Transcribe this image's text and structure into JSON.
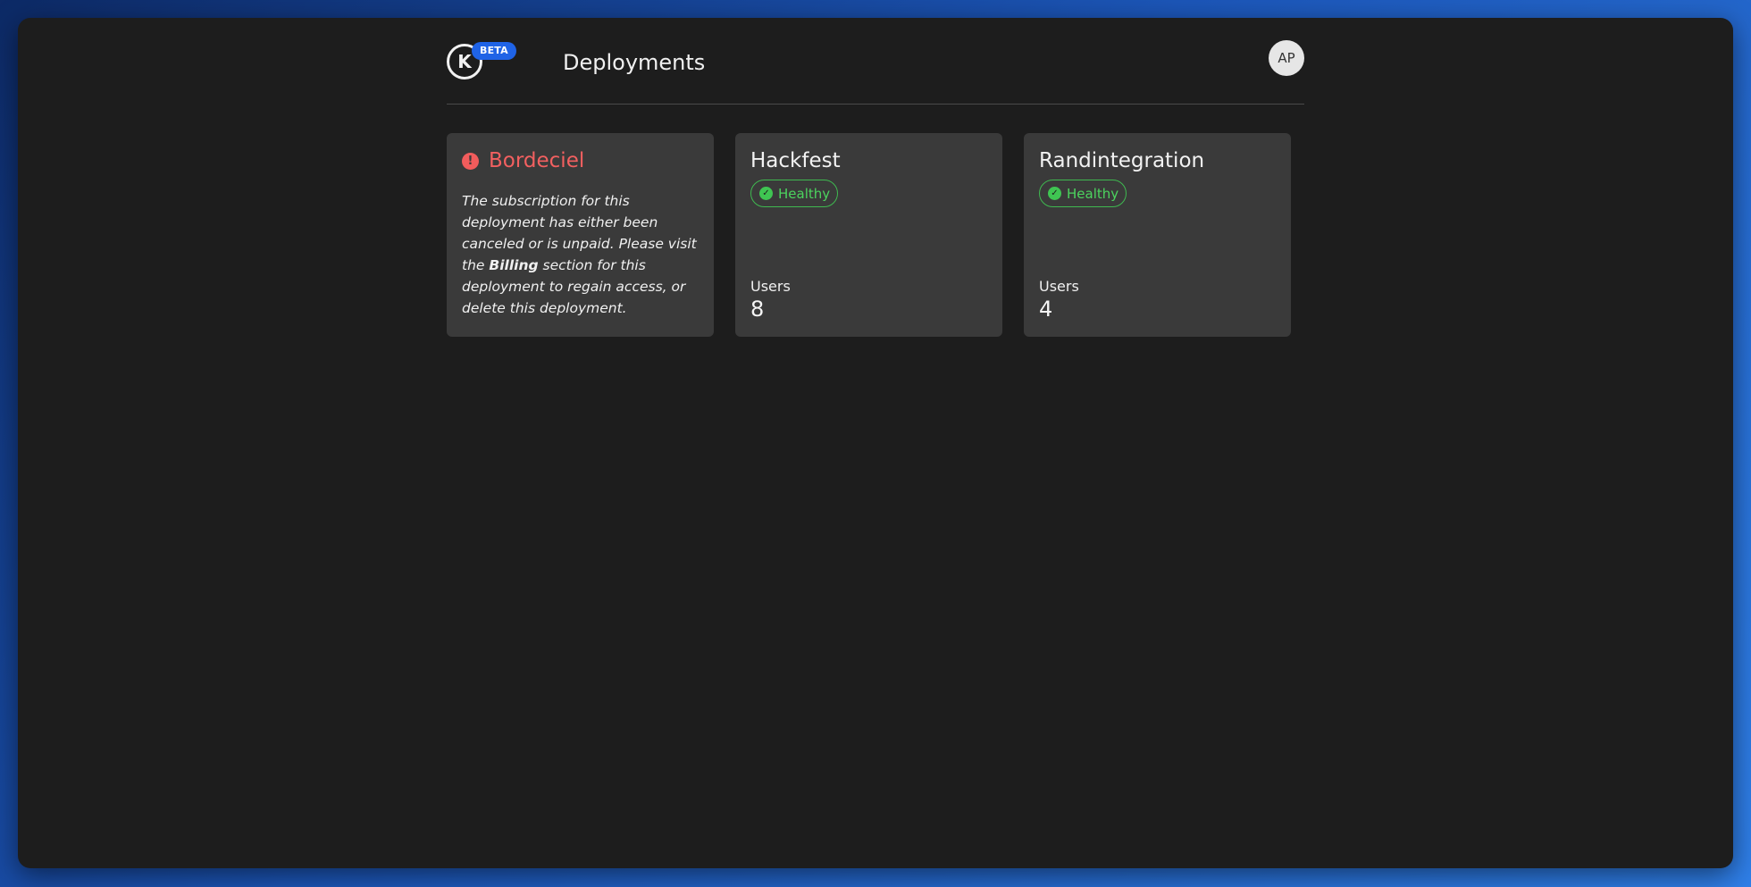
{
  "header": {
    "logo_letter": "K",
    "beta_label": "BETA",
    "title": "Deployments",
    "avatar_initials": "AP"
  },
  "deployments": [
    {
      "name": "Bordeciel",
      "state": "error",
      "message": {
        "part1": "The subscription for this deployment has either been canceled or is unpaid. Please visit the ",
        "link": "Billing",
        "part2": " section for this deployment to regain access, or delete this deployment."
      }
    },
    {
      "name": "Hackfest",
      "status": "Healthy",
      "users_label": "Users",
      "users": "8"
    },
    {
      "name": "Randintegration",
      "status": "Healthy",
      "users_label": "Users",
      "users": "4"
    }
  ],
  "icons": {
    "error": "alert-circle-icon",
    "healthy": "check-circle-icon"
  },
  "colors": {
    "error": "#f26060",
    "healthy": "#4cd35e",
    "beta": "#1f63e6"
  }
}
